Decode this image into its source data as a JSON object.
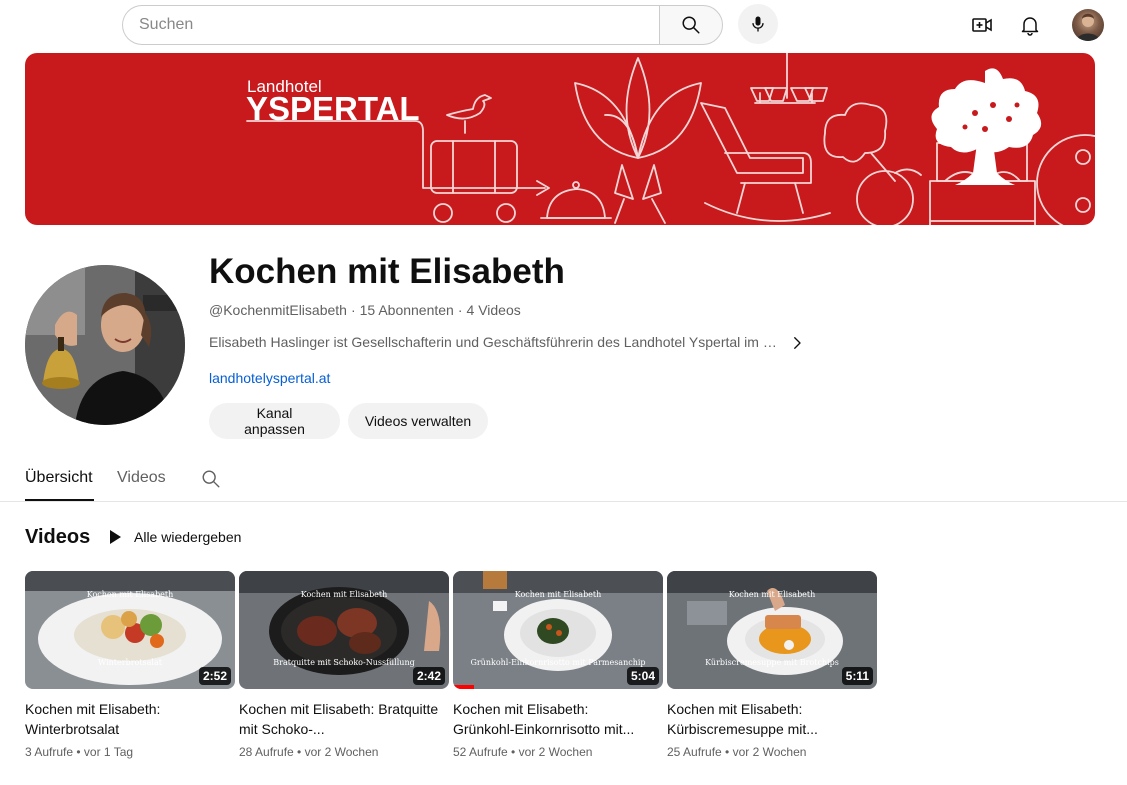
{
  "topbar": {
    "search_placeholder": "Suchen",
    "icons": [
      "search-icon",
      "mic-icon",
      "create-video-icon",
      "notifications-icon",
      "account-avatar"
    ]
  },
  "banner": {
    "brand_small": "Landhotel",
    "brand_big": "YSPERTAL",
    "color": "#c8191d"
  },
  "channel": {
    "name": "Kochen mit Elisabeth",
    "handle": "@KochenmitElisabeth",
    "subscribers": "15 Abonnenten",
    "video_count": "4 Videos",
    "separator": "·",
    "description": "Elisabeth Haslinger ist Gesellschafterin und Geschäftsführerin des Landhotel Yspertal im s...",
    "link": "landhotelyspertal.at",
    "buttons": {
      "customize": "Kanal anpassen",
      "manage": "Videos verwalten"
    }
  },
  "tabs": [
    {
      "label": "Übersicht",
      "active": true
    },
    {
      "label": "Videos",
      "active": false
    }
  ],
  "section": {
    "title": "Videos",
    "play_all": "Alle wiedergeben"
  },
  "videos": [
    {
      "title": "Kochen mit Elisabeth: Winterbrotsalat",
      "duration": "2:52",
      "views": "3 Aufrufe",
      "age": "vor 1 Tag",
      "overlay_title": "Kochen mit Elisabeth",
      "overlay_sub": "Winterbrotsalat",
      "watched_fraction": 0
    },
    {
      "title": "Kochen mit Elisabeth: Bratquitte mit Schoko-...",
      "duration": "2:42",
      "views": "28 Aufrufe",
      "age": "vor 2 Wochen",
      "overlay_title": "Kochen mit Elisabeth",
      "overlay_sub": "Bratquitte mit Schoko-Nussfüllung",
      "watched_fraction": 0
    },
    {
      "title": "Kochen mit Elisabeth: Grünkohl-Einkornrisotto mit...",
      "duration": "5:04",
      "views": "52 Aufrufe",
      "age": "vor 2 Wochen",
      "overlay_title": "Kochen mit Elisabeth",
      "overlay_sub": "Grünkohl-Einkornrisotto mit Parmesanchip",
      "watched_fraction": 0.1
    },
    {
      "title": "Kochen mit Elisabeth: Kürbiscremesuppe mit...",
      "duration": "5:11",
      "views": "25 Aufrufe",
      "age": "vor 2 Wochen",
      "overlay_title": "Kochen mit Elisabeth",
      "overlay_sub": "Kürbiscremesuppe mit Brotchips",
      "watched_fraction": 0
    }
  ]
}
